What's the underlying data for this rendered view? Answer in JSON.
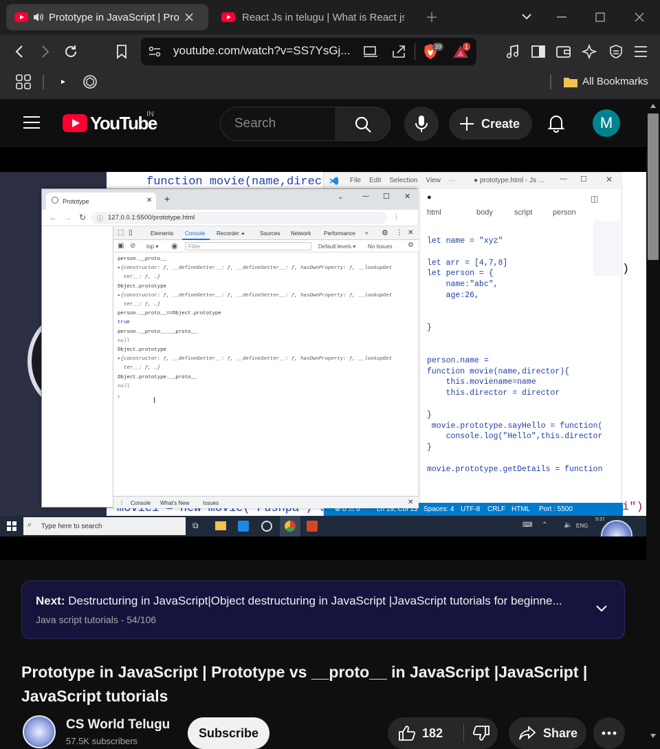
{
  "browser": {
    "tabs": [
      {
        "title": "Prototype in JavaScript | Prot",
        "active": true
      },
      {
        "title": "React Js in telugu | What is React js",
        "active": false
      }
    ],
    "url": "youtube.com/watch?v=SS7YsGj...",
    "brave_badge": "39",
    "alert_badge": "1",
    "bookmarks_label": "All Bookmarks"
  },
  "youtube": {
    "logo": "YouTube",
    "region": "IN",
    "search_placeholder": "Search",
    "create_label": "Create",
    "avatar_letter": "M"
  },
  "video_frame": {
    "code_top": "function movie(name,directo",
    "code_bottom": "movie1 = new movie(\"Pushpa\", Su",
    "code_right_paren": ")",
    "code_right_tail": "i\")",
    "devtools": {
      "tab_title": "Prototype",
      "address": "127.0.0.1:5500/prototype.html",
      "tabs": [
        "Elements",
        "Console",
        "Recorder ⏶",
        "Sources",
        "Network",
        "Performance",
        "»"
      ],
      "filter_placeholder": "Filter",
      "context": "top ▾",
      "levels": "Default levels ▾",
      "issues": "No Issues",
      "console_lines": [
        "person.__proto__",
        "▸{constructor: ƒ, __defineGetter__: ƒ, __defineSetter__: ƒ, hasOwnProperty: ƒ, __lookupGet",
        "  ter__: ƒ, …}",
        "Object.prototype",
        "▸{constructor: ƒ, __defineGetter__: ƒ, __defineSetter__: ƒ, hasOwnProperty: ƒ, __lookupGet",
        "  ter__: ƒ, …}",
        "person.__proto__==Object.prototype",
        "true",
        "person.__proto__.__proto__",
        "null",
        "Object.prototype",
        "▸{constructor: ƒ, __defineGetter__: ƒ, __defineSetter__: ƒ, hasOwnProperty: ƒ, __lookupGet",
        "  ter__: ƒ, …}",
        "Object.prototype.__proto__",
        "null"
      ],
      "drawer_tabs": [
        "Console",
        "What's New",
        "Issues"
      ]
    },
    "vscode": {
      "menu": [
        "File",
        "Edit",
        "Selection",
        "View",
        "···"
      ],
      "title": "● prototype.html - Js ...",
      "breadcrumb": [
        "html",
        "body",
        "script",
        "person"
      ],
      "code_lines": [
        "let name = \"xyz\"",
        "",
        "let arr = [4,7,8]",
        "let person = {",
        "    name:\"abc\",",
        "    age:26,",
        "",
        "",
        "}",
        "",
        "",
        "person.name =",
        "function movie(name,director){",
        "    this.moviename=name",
        "    this.director = director",
        "",
        "}",
        " movie.prototype.sayHello = function(",
        "    console.log(\"Hello\",this.director",
        "}",
        "",
        "movie.prototype.getDetails = function"
      ],
      "status_items": [
        "⊗ 0 ⚠ 0",
        "Ln 19, Col 13",
        "Spaces: 4",
        "UTF-8",
        "CRLF",
        "HTML",
        "Port : 5500"
      ]
    },
    "taskbar": {
      "search_placeholder": "Type here to search",
      "lang": "ENG",
      "time": "9:37"
    }
  },
  "next_card": {
    "prefix": "Next:",
    "title": "Destructuring in JavaScript|Object destructuring in JavaScript |JavaScript tutorials for beginne...",
    "playlist": "Java script tutorials",
    "position": "- 54/106"
  },
  "video": {
    "title": "Prototype in JavaScript | Prototype vs __proto__ in JavaScript |JavaScript | JavaScript tutorials",
    "channel": "CS World Telugu",
    "subscribers": "57.5K subscribers",
    "subscribe_label": "Subscribe",
    "likes": "182",
    "share_label": "Share"
  }
}
